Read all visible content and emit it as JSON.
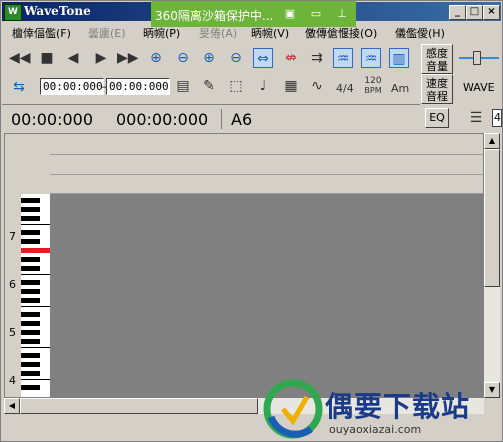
{
  "window": {
    "title": "WaveTone"
  },
  "sandbox": {
    "text": "360隔离沙箱保护中..."
  },
  "menu": [
    {
      "label": "檀倖偪儖(F)",
      "dim": false
    },
    {
      "label": "曇廤(E)",
      "dim": true
    },
    {
      "label": "昞帵(P)",
      "dim": false
    },
    {
      "label": "旻倦(A)",
      "dim": true
    },
    {
      "label": "昞帵(V)",
      "dim": false
    },
    {
      "label": "儌傳傖愝掕(O)",
      "dim": false
    },
    {
      "label": "儀儖僾(H)",
      "dim": false
    }
  ],
  "right_panel": {
    "sensitivity": "感度\n音量",
    "speed": "速度\n音程",
    "wave": "WAVE",
    "eq": "EQ",
    "field_value": "4"
  },
  "toolbar": {
    "time_start": "00:00:000",
    "time_end": "00:00:000",
    "time_sep": "–",
    "meter": "4/4",
    "tempo_top": "120",
    "tempo_bottom": "BPM",
    "chord": "Am"
  },
  "status": {
    "time_a": "00:00:000",
    "time_b": "000:00:000",
    "note": "A6"
  },
  "piano": {
    "octaves": [
      "7",
      "6",
      "5",
      "4"
    ]
  },
  "watermark": {
    "title": "偶要下载站",
    "url": "ouyaoxiazai.com"
  },
  "colors": {
    "title_bar": "#0a246a",
    "sandbox": "#6fb43a",
    "grid": "#808080",
    "highlight_key": "#e02020"
  }
}
